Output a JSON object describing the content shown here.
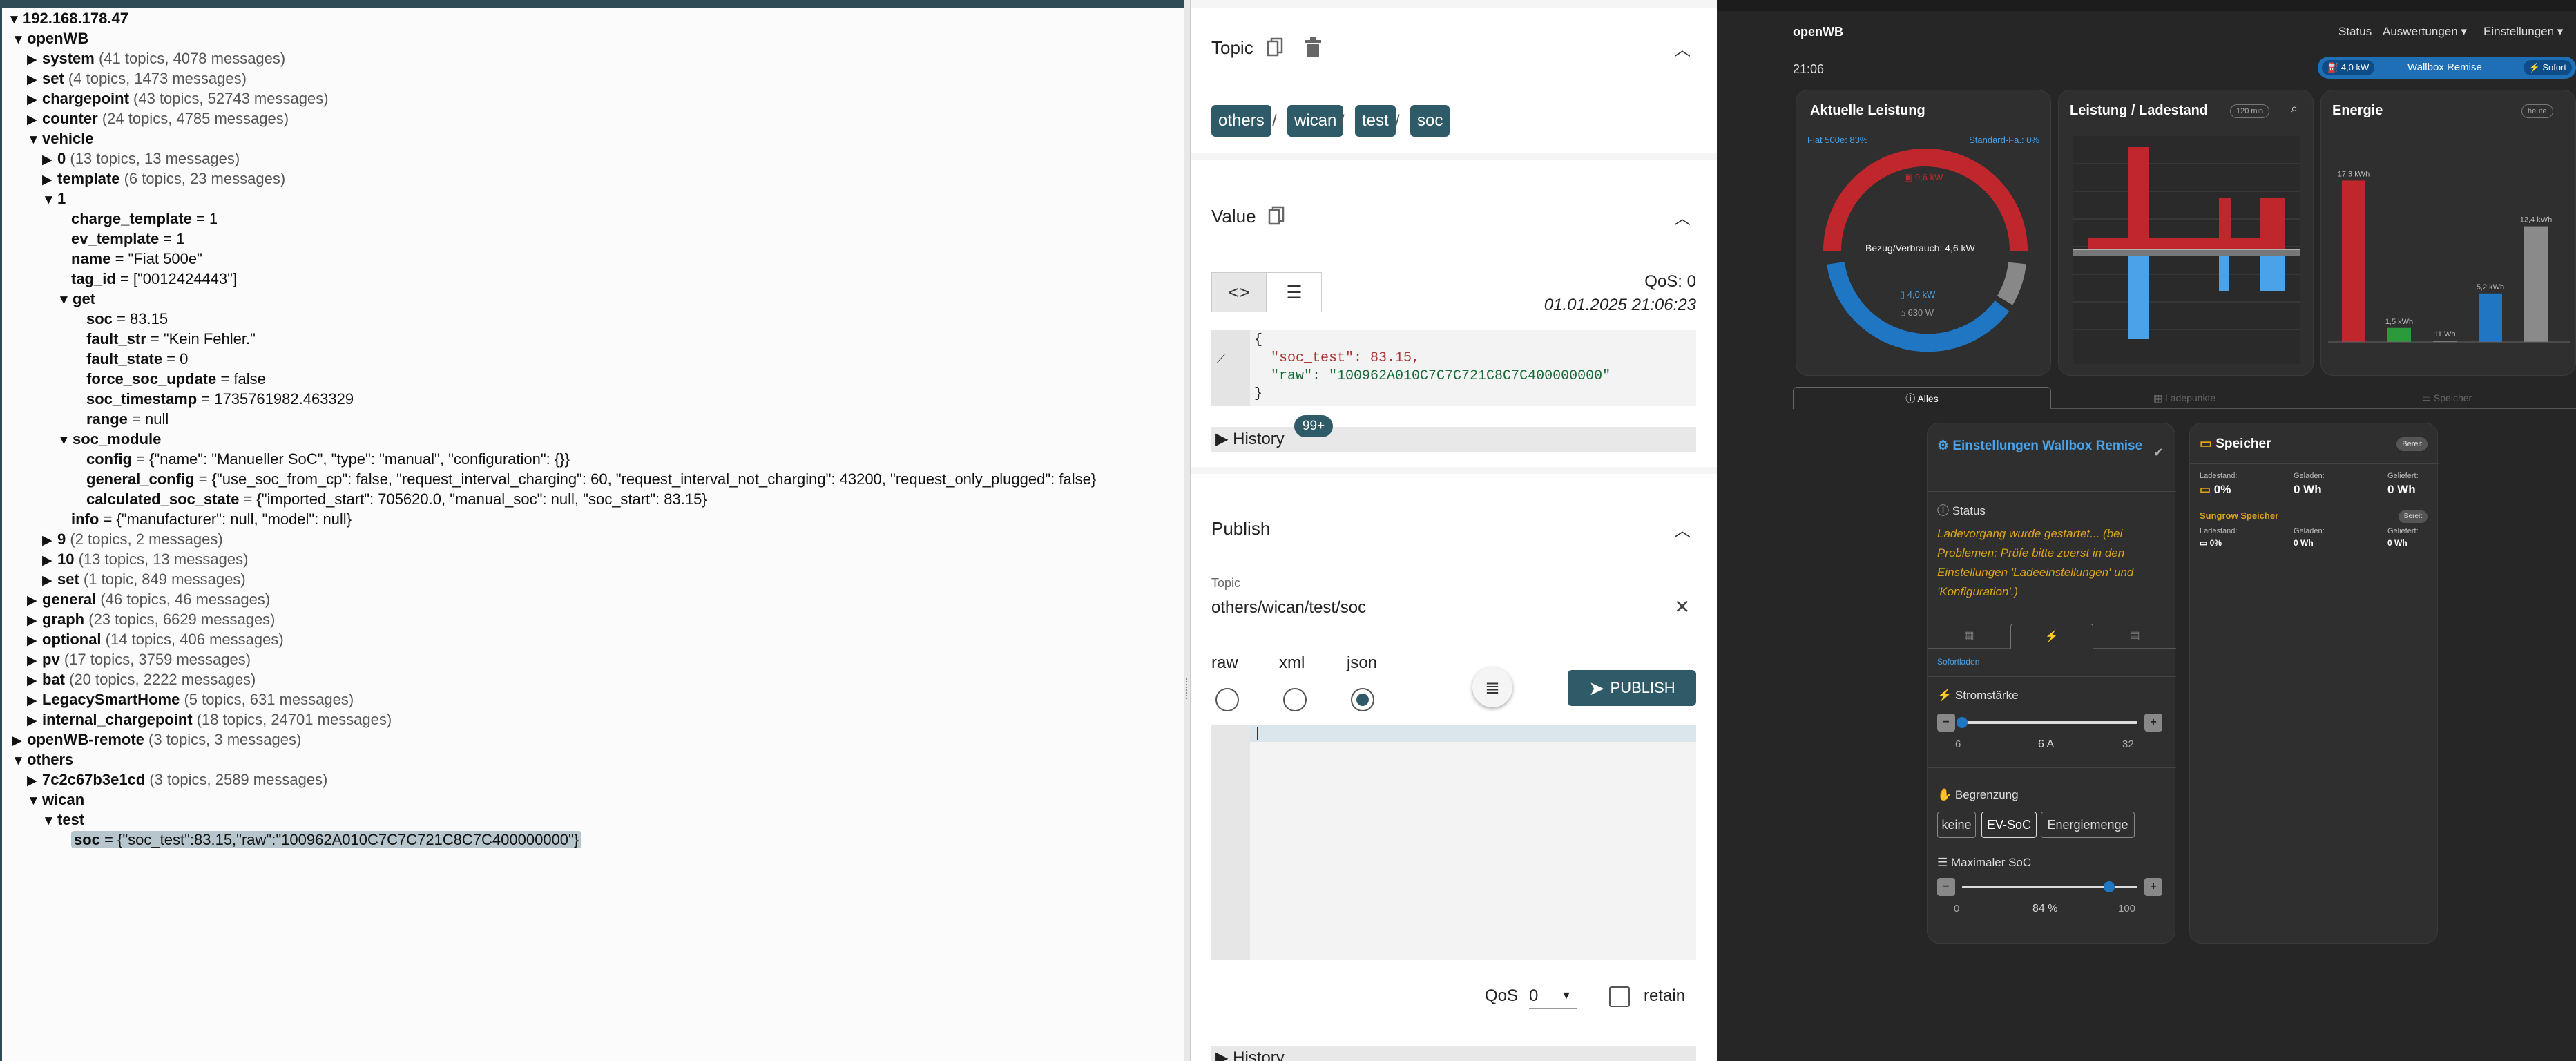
{
  "tree": {
    "host": "192.168.178.47",
    "nodes": [
      {
        "label": "openWB",
        "meta": "",
        "indent": 0,
        "open": true,
        "bold": true
      },
      {
        "label": "system",
        "meta": "(41 topics, 4078 messages)",
        "indent": 1,
        "open": false,
        "bold": true
      },
      {
        "label": "set",
        "meta": "(4 topics, 1473 messages)",
        "indent": 1,
        "open": false,
        "bold": true
      },
      {
        "label": "chargepoint",
        "meta": "(43 topics, 52743 messages)",
        "indent": 1,
        "open": false,
        "bold": true
      },
      {
        "label": "counter",
        "meta": "(24 topics, 4785 messages)",
        "indent": 1,
        "open": false,
        "bold": true
      },
      {
        "label": "vehicle",
        "meta": "",
        "indent": 1,
        "open": true,
        "bold": true
      },
      {
        "label": "0",
        "meta": "(13 topics, 13 messages)",
        "indent": 2,
        "open": false,
        "bold": true
      },
      {
        "label": "template",
        "meta": "(6 topics, 23 messages)",
        "indent": 2,
        "open": false,
        "bold": true
      },
      {
        "label": "1",
        "meta": "",
        "indent": 2,
        "open": true,
        "bold": true
      },
      {
        "label": "charge_template",
        "meta": " = 1",
        "indent": 3,
        "leaf": true
      },
      {
        "label": "ev_template",
        "meta": " = 1",
        "indent": 3,
        "leaf": true
      },
      {
        "label": "name",
        "meta": " = \"Fiat 500e\"",
        "indent": 3,
        "leaf": true
      },
      {
        "label": "tag_id",
        "meta": " = [\"0012424443\"]",
        "indent": 3,
        "leaf": true
      },
      {
        "label": "get",
        "meta": "",
        "indent": 3,
        "open": true,
        "bold": true
      },
      {
        "label": "soc",
        "meta": " = 83.15",
        "indent": 4,
        "leaf": true
      },
      {
        "label": "fault_str",
        "meta": " = \"Kein Fehler.\"",
        "indent": 4,
        "leaf": true
      },
      {
        "label": "fault_state",
        "meta": " = 0",
        "indent": 4,
        "leaf": true
      },
      {
        "label": "force_soc_update",
        "meta": " = false",
        "indent": 4,
        "leaf": true
      },
      {
        "label": "soc_timestamp",
        "meta": " = 1735761982.463329",
        "indent": 4,
        "leaf": true
      },
      {
        "label": "range",
        "meta": " = null",
        "indent": 4,
        "leaf": true
      },
      {
        "label": "soc_module",
        "meta": "",
        "indent": 3,
        "open": true,
        "bold": true
      },
      {
        "label": "config",
        "meta": " = {\"name\": \"Manueller SoC\", \"type\": \"manual\", \"configuration\": {}}",
        "indent": 4,
        "leaf": true
      },
      {
        "label": "general_config",
        "meta": " = {\"use_soc_from_cp\": false, \"request_interval_charging\": 60, \"request_interval_not_charging\": 43200, \"request_only_plugged\": false}",
        "indent": 4,
        "leaf": true
      },
      {
        "label": "calculated_soc_state",
        "meta": " = {\"imported_start\": 705620.0, \"manual_soc\": null, \"soc_start\": 83.15}",
        "indent": 4,
        "leaf": true
      },
      {
        "label": "info",
        "meta": " = {\"manufacturer\": null, \"model\": null}",
        "indent": 3,
        "leaf": true
      },
      {
        "label": "9",
        "meta": "(2 topics, 2 messages)",
        "indent": 2,
        "open": false,
        "bold": true
      },
      {
        "label": "10",
        "meta": "(13 topics, 13 messages)",
        "indent": 2,
        "open": false,
        "bold": true
      },
      {
        "label": "set",
        "meta": "(1 topic, 849 messages)",
        "indent": 2,
        "open": false,
        "bold": true
      },
      {
        "label": "general",
        "meta": "(46 topics, 46 messages)",
        "indent": 1,
        "open": false,
        "bold": true
      },
      {
        "label": "graph",
        "meta": "(23 topics, 6629 messages)",
        "indent": 1,
        "open": false,
        "bold": true
      },
      {
        "label": "optional",
        "meta": "(14 topics, 406 messages)",
        "indent": 1,
        "open": false,
        "bold": true
      },
      {
        "label": "pv",
        "meta": "(17 topics, 3759 messages)",
        "indent": 1,
        "open": false,
        "bold": true
      },
      {
        "label": "bat",
        "meta": "(20 topics, 2222 messages)",
        "indent": 1,
        "open": false,
        "bold": true
      },
      {
        "label": "LegacySmartHome",
        "meta": "(5 topics, 631 messages)",
        "indent": 1,
        "open": false,
        "bold": true
      },
      {
        "label": "internal_chargepoint",
        "meta": "(18 topics, 24701 messages)",
        "indent": 1,
        "open": false,
        "bold": true
      },
      {
        "label": "openWB-remote",
        "meta": "(3 topics, 3 messages)",
        "indent": 0,
        "open": false,
        "bold": true
      },
      {
        "label": "others",
        "meta": "",
        "indent": 0,
        "open": true,
        "bold": true
      },
      {
        "label": "7c2c67b3e1cd",
        "meta": "(3 topics, 2589 messages)",
        "indent": 1,
        "open": false,
        "bold": true
      },
      {
        "label": "wican",
        "meta": "",
        "indent": 1,
        "open": true,
        "bold": true
      },
      {
        "label": "test",
        "meta": "",
        "indent": 2,
        "open": true,
        "bold": true
      },
      {
        "label": "soc",
        "meta": " = {\"soc_test\":83.15,\"raw\":\"100962A010C7C7C721C8C7C400000000\"}",
        "indent": 3,
        "leaf": true,
        "highlight": true
      }
    ]
  },
  "topic": {
    "title": "Topic",
    "chips": [
      "others",
      "wican",
      "test",
      "soc"
    ],
    "separator": "/"
  },
  "value": {
    "title": "Value",
    "qos": "QoS: 0",
    "timestamp": "01.01.2025 21:06:23",
    "code_lines": [
      "{",
      "  \"soc_test\": 83.15,",
      "  \"raw\": \"100962A010C7C7C721C8C7C400000000\"",
      "}"
    ],
    "history_label": "History",
    "history_badge": "99+"
  },
  "publish": {
    "title": "Publish",
    "topic_label": "Topic",
    "topic_value": "others/wican/test/soc",
    "formats": [
      "raw",
      "xml",
      "json"
    ],
    "selected_format": "json",
    "publish_label": "PUBLISH",
    "qos_label": "QoS",
    "qos_value": "0",
    "retain_label": "retain",
    "history_label": "History"
  },
  "app": {
    "brand": "openWB",
    "nav": [
      "Status",
      "Auswertungen",
      "Einstellungen"
    ],
    "time": "21:06",
    "wallbox_power": "4,0 kW",
    "wallbox_name": "Wallbox Remise",
    "wallbox_mode": "Sofort",
    "leistung": {
      "title": "Aktuelle Leistung",
      "left": "Fiat 500e: 83%",
      "right": "Standard-Fa.: 0%",
      "pv": "9,6 kW",
      "center": "Bezug/Verbrauch: 4,6 kW",
      "car": "4,0 kW",
      "house": "630 W"
    },
    "ladestand": {
      "title": "Leistung / Ladestand",
      "range": "120 min"
    },
    "energie": {
      "title": "Energie",
      "period": "heute",
      "bars": [
        {
          "label": "17,3 kWh",
          "value": 17.3,
          "color": "#c0272d"
        },
        {
          "label": "1,5 kWh",
          "value": 1.5,
          "color": "#2a9a3a"
        },
        {
          "label": "11 Wh",
          "value": 0.011,
          "color": "#888888"
        },
        {
          "label": "5,2 kWh",
          "value": 5.2,
          "color": "#1f77c4"
        },
        {
          "label": "12,4 kWh",
          "value": 12.4,
          "color": "#8a8a8a"
        }
      ]
    },
    "tabs": [
      "Alles",
      "Ladepunkte",
      "Speicher"
    ],
    "settings": {
      "title": "Einstellungen Wallbox Remise",
      "status_label": "Status",
      "status_text": "Ladevorgang wurde gestartet... (bei Problemen: Prüfe bitte zuerst in den Einstellungen 'Ladeeinstellungen' und 'Konfiguration'.)",
      "sofortladen": "Sofortladen",
      "strom_label": "Stromstärke",
      "strom_min": "6",
      "strom_value": "6 A",
      "strom_max": "32",
      "strom_fraction": 0.0,
      "begrenzung_label": "Begrenzung",
      "begrenzung_options": [
        "keine",
        "EV-SoC",
        "Energiemenge"
      ],
      "begrenzung_selected": "EV-SoC",
      "soc_label": "Maximaler SoC",
      "soc_min": "0",
      "soc_value": "84 %",
      "soc_max": "100",
      "soc_fraction": 0.84
    },
    "speicher": {
      "title": "Speicher",
      "badge": "Bereit",
      "cols": [
        "Ladestand:",
        "Geladen:",
        "Geliefert:"
      ],
      "vals": [
        "0%",
        "0 Wh",
        "0 Wh"
      ],
      "sub_title": "Sungrow Speicher",
      "sub_badge": "Bereit",
      "sub_vals": [
        "0%",
        "0 Wh",
        "0 Wh"
      ]
    }
  }
}
